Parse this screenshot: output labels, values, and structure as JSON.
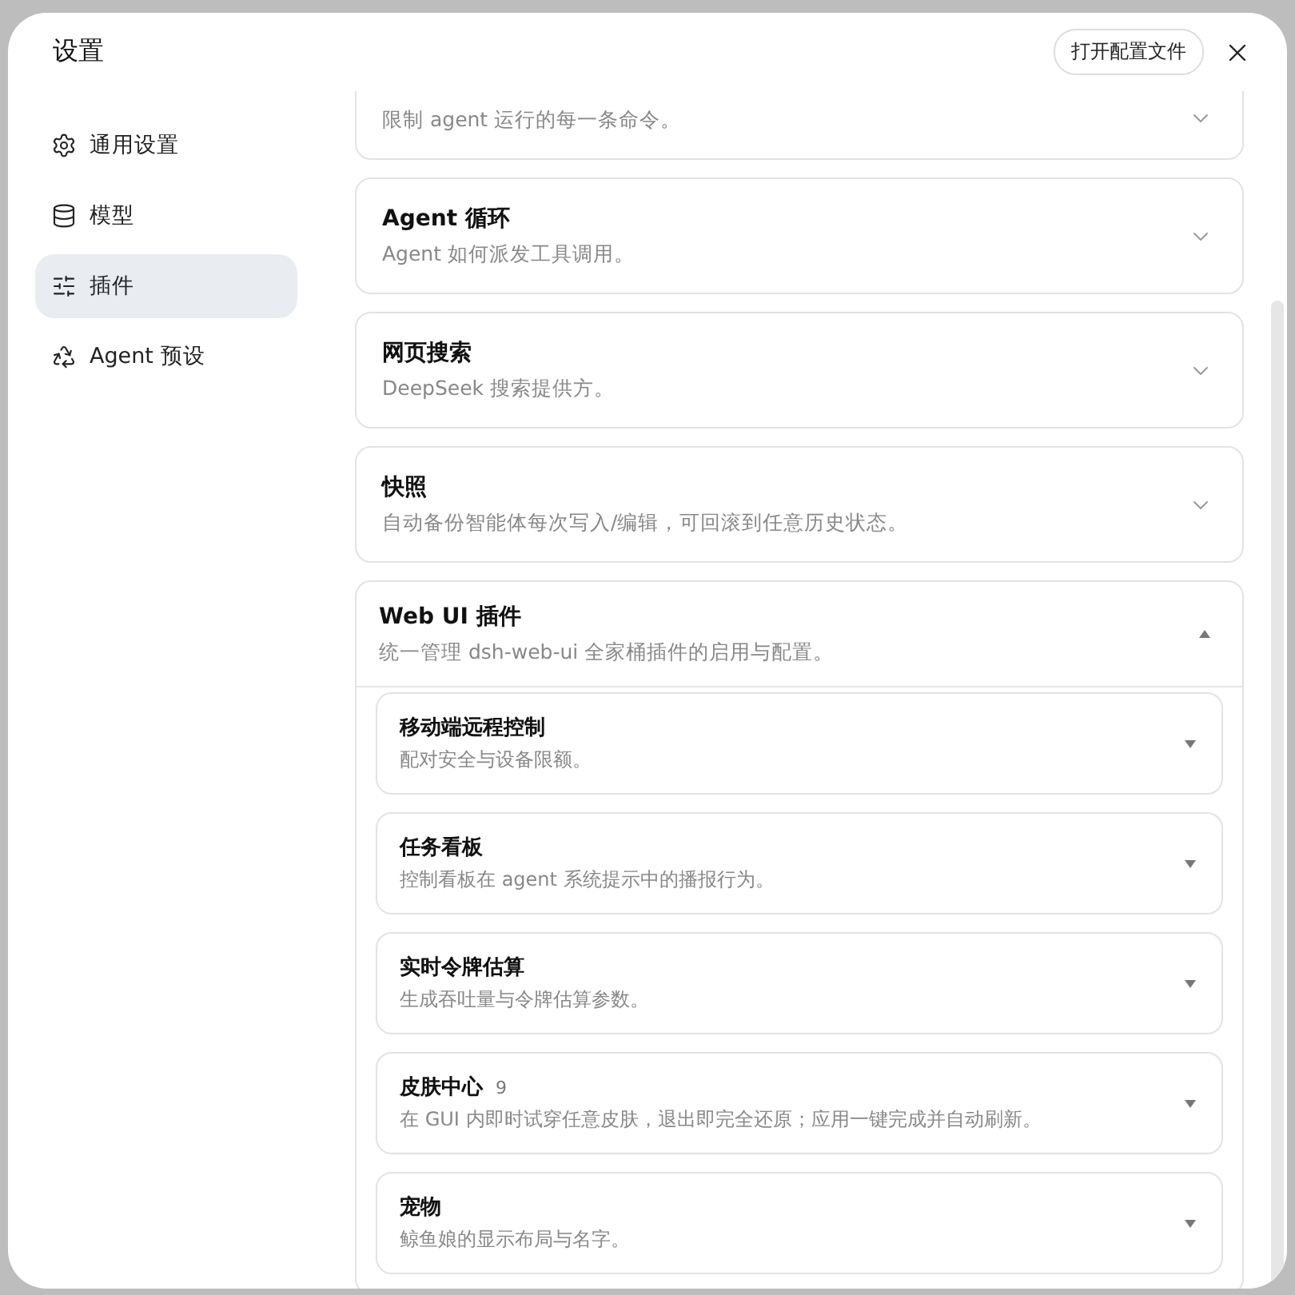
{
  "dialog": {
    "title": "设置",
    "open_config_button": "打开配置文件"
  },
  "sidebar": {
    "items": [
      {
        "label": "通用设置",
        "selected": false
      },
      {
        "label": "模型",
        "selected": false
      },
      {
        "label": "插件",
        "selected": true
      },
      {
        "label": "Agent 预设",
        "selected": false
      }
    ]
  },
  "sections": [
    {
      "description": "限制 agent 运行的每一条命令。",
      "expanded": false
    },
    {
      "title": "Agent 循环",
      "description": "Agent 如何派发工具调用。",
      "expanded": false
    },
    {
      "title": "网页搜索",
      "description": "DeepSeek 搜索提供方。",
      "expanded": false
    },
    {
      "title": "快照",
      "description": "自动备份智能体每次写入/编辑，可回滚到任意历史状态。",
      "expanded": false
    },
    {
      "title": "Web UI 插件",
      "description": "统一管理 dsh-web-ui 全家桶插件的启用与配置。",
      "expanded": true,
      "children": [
        {
          "title": "移动端远程控制",
          "description": "配对安全与设备限额。",
          "expanded": false
        },
        {
          "title": "任务看板",
          "description": "控制看板在 agent 系统提示中的播报行为。",
          "expanded": false
        },
        {
          "title": "实时令牌估算",
          "description": "生成吞吐量与令牌估算参数。",
          "expanded": false
        },
        {
          "title": "皮肤中心",
          "badge": "9",
          "description": "在 GUI 内即时试穿任意皮肤，退出即完全还原；应用一键完成并自动刷新。",
          "expanded": false
        },
        {
          "title": "宠物",
          "description": "鲸鱼娘的显示布局与名字。",
          "expanded": false
        }
      ]
    }
  ]
}
